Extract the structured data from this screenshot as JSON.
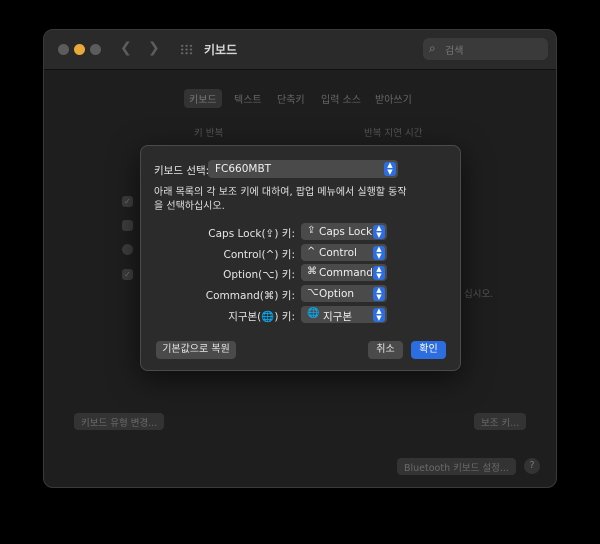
{
  "window": {
    "title": "키보드",
    "search_placeholder": "검색",
    "tabs": [
      {
        "label": "키보드",
        "selected": true
      },
      {
        "label": "텍스트",
        "selected": false
      },
      {
        "label": "단축키",
        "selected": false
      },
      {
        "label": "입력 소스",
        "selected": false
      },
      {
        "label": "받아쓰기",
        "selected": false
      }
    ],
    "bg_labels": {
      "key_repeat": "키 반복",
      "repeat_delay": "반복 지연 시간",
      "partial_text": "십시오."
    },
    "bg_buttons": {
      "keyboard_type": "키보드 유형 변경...",
      "modifier_keys": "보조 키...",
      "bluetooth": "Bluetooth 키보드 설정...",
      "help": "?"
    }
  },
  "sheet": {
    "keyboard_label": "키보드 선택:",
    "keyboard_value": "FC660MBT",
    "description": "아래 목록의 각 보조 키에 대하여, 팝업 메뉴에서 실행할 동작을 선택하십시오.",
    "mappings": [
      {
        "label": "Caps Lock(⇪) 키:",
        "symbol": "⇪",
        "value": "Caps Lock"
      },
      {
        "label": "Control(^) 키:",
        "symbol": "^",
        "value": "Control"
      },
      {
        "label": "Option(⌥) 키:",
        "symbol": "⌘",
        "value": "Command"
      },
      {
        "label": "Command(⌘) 키:",
        "symbol": "⌥",
        "value": "Option"
      },
      {
        "label": "지구본(🌐) 키:",
        "symbol": "🌐",
        "value": "지구본"
      }
    ],
    "restore_button": "기본값으로 복원",
    "cancel_button": "취소",
    "ok_button": "확인"
  },
  "colors": {
    "accent": "#2c6ee0",
    "minimize": "#e8a83a"
  },
  "icons": {
    "back": "chevron-left-icon",
    "forward": "chevron-right-icon",
    "grid": "grid-icon",
    "search": "search-icon"
  }
}
